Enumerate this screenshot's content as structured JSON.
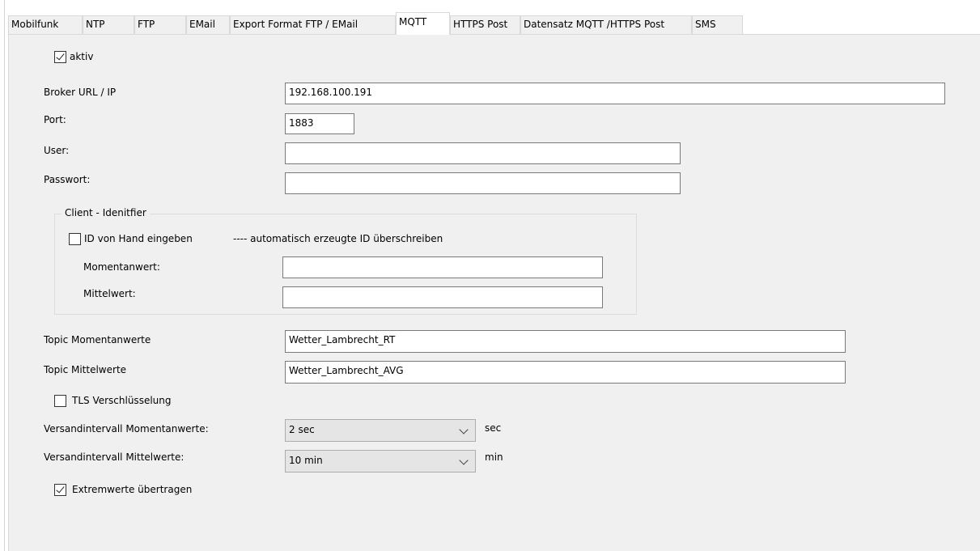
{
  "tabs": [
    {
      "label": "Mobilfunk",
      "active": false
    },
    {
      "label": "NTP",
      "active": false
    },
    {
      "label": "FTP",
      "active": false
    },
    {
      "label": "EMail",
      "active": false
    },
    {
      "label": "Export Format  FTP / EMail",
      "active": false
    },
    {
      "label": "MQTT",
      "active": true
    },
    {
      "label": "HTTPS Post",
      "active": false
    },
    {
      "label": "Datensatz MQTT /HTTPS Post",
      "active": false
    },
    {
      "label": "SMS",
      "active": false
    }
  ],
  "aktiv": {
    "label": "aktiv",
    "checked": true
  },
  "broker": {
    "label": "Broker  URL /  IP",
    "value": "192.168.100.191"
  },
  "port": {
    "label": "Port:",
    "value": "1883"
  },
  "user": {
    "label": "User:",
    "value": ""
  },
  "passwort": {
    "label": "Passwort:",
    "value": ""
  },
  "client": {
    "group_title": "Client - Idenitfier",
    "manual_id": {
      "label": "ID von Hand eingeben",
      "checked": false
    },
    "note": "----  automatisch erzeugte ID überschreiben",
    "momentanwert": {
      "label": "Momentanwert:",
      "value": ""
    },
    "mittelwert": {
      "label": "Mittelwert:",
      "value": ""
    }
  },
  "topic_momentan": {
    "label": "Topic Momentanwerte",
    "value": "Wetter_Lambrecht_RT"
  },
  "topic_mittel": {
    "label": "Topic Mittelwerte",
    "value": "Wetter_Lambrecht_AVG"
  },
  "tls": {
    "label": "TLS Verschlüsselung",
    "checked": false
  },
  "interval_momentan": {
    "label": "Versandintervall Momentanwerte:",
    "value": "2 sec",
    "unit": "sec"
  },
  "interval_mittel": {
    "label": "Versandintervall Mittelwerte:",
    "value": "10 min",
    "unit": "min"
  },
  "extremwerte": {
    "label": "Extremwerte übertragen",
    "checked": true
  },
  "colors": {
    "panel": "#f0f0f0",
    "field_border": "#7a7a7a",
    "combo_bg": "#e5e5e5"
  }
}
